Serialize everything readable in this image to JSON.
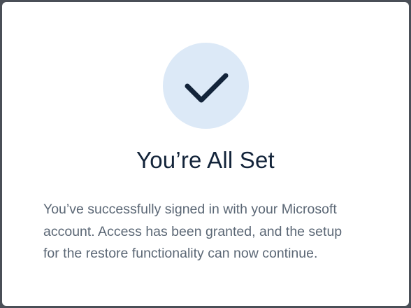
{
  "dialog": {
    "icon": "checkmark-icon",
    "title": "You’re All Set",
    "message_lines": [
      "You’ve successfully signed in with your Microsoft",
      "account. Access has been granted, and the setup",
      "for the restore functionality can now continue."
    ]
  },
  "colors": {
    "backdrop": "#4a4f57",
    "card": "#ffffff",
    "icon_circle": "#dce9f7",
    "checkmark": "#13243a",
    "title": "#13243a",
    "body_text": "#5b6775"
  }
}
